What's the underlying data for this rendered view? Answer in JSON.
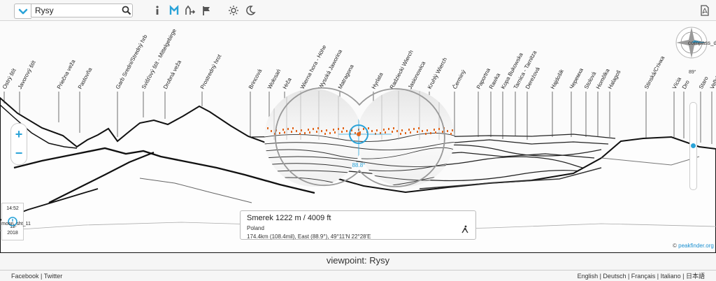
{
  "toolbar": {
    "search_value": "Rysy",
    "icons": [
      "chevron-down-icon",
      "search-icon",
      "info-icon",
      "bold-icon",
      "mountain-icon",
      "elevation-icon",
      "flag-icon",
      "sun-icon",
      "moon-icon",
      "pdf-icon"
    ]
  },
  "peaks": [
    {
      "label": "Ostrý štít"
    },
    {
      "label": "Javorový štít"
    },
    {
      "label": "Priečna veža"
    },
    {
      "label": "Pastovňa"
    },
    {
      "label": "Garb Sredni/Stredný hrb"
    },
    {
      "label": "Svišťový štít - Mittelgebirge"
    },
    {
      "label": "Drobná veža"
    },
    {
      "label": "Prostredný hrot"
    },
    {
      "label": "Brincová"
    },
    {
      "label": "Wołosań"
    },
    {
      "label": "Hrča"
    },
    {
      "label": "Wierna hora - Höhe"
    },
    {
      "label": "Wysoká Jaworina"
    },
    {
      "label": "Matragona"
    },
    {
      "label": "Hyrlata"
    },
    {
      "label": "Radziecki Wierch"
    },
    {
      "label": "Jasionowica"
    },
    {
      "label": "Kruhlý Wierch"
    },
    {
      "label": "Čerminý"
    },
    {
      "label": "Paportna"
    },
    {
      "label": "Rawka"
    },
    {
      "label": "Kopa Bukowska"
    },
    {
      "label": "Tarnica - Tarnitza"
    },
    {
      "label": "Dereżová"
    },
    {
      "label": "Hajdošik"
    },
    {
      "label": "Черемха"
    },
    {
      "label": "Stolová"
    },
    {
      "label": "Homôlka"
    },
    {
      "label": "Halagoš"
    },
    {
      "label": "Stinská/Стінка"
    },
    {
      "label": "Vícia"
    },
    {
      "label": "Dro"
    },
    {
      "label": "Staro"
    },
    {
      "label": "Veľký Ka"
    }
  ],
  "binocular": {
    "heading": "88.8°"
  },
  "zoom": {
    "in": "+",
    "out": "−"
  },
  "time": {
    "clock": "14:52",
    "moon": "moon_sht_11",
    "day": "12",
    "year": "2018"
  },
  "compass": {
    "label": "compass_direct",
    "degrees": "89°"
  },
  "info": {
    "title": "Smerek 1222 m / 4009 ft",
    "country": "Poland",
    "coords": "174.4km (108.4mil), East (88.9°), 49°11'N 22°28'E"
  },
  "credit": {
    "prefix": "©",
    "brand": "peakfinder.org"
  },
  "caption": "viewpoint: Rysy",
  "footer": {
    "left": "Facebook | Twitter",
    "right": "English | Deutsch | Français | Italiano | 日本語"
  },
  "colors": {
    "accent": "#2aa3d8",
    "marker": "#e2661c"
  }
}
